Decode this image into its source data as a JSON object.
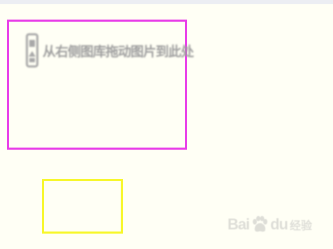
{
  "drop_zone": {
    "hint_text": "从右侧图库拖动图片到此处",
    "icon": "image-upload-icon",
    "border_color": "#e83be8"
  },
  "secondary_box": {
    "border_color": "#f7f728"
  },
  "watermark": {
    "left_text": "Bai",
    "right_text": "du",
    "sub_text": "经验",
    "icon": "baidu-paw-icon"
  }
}
